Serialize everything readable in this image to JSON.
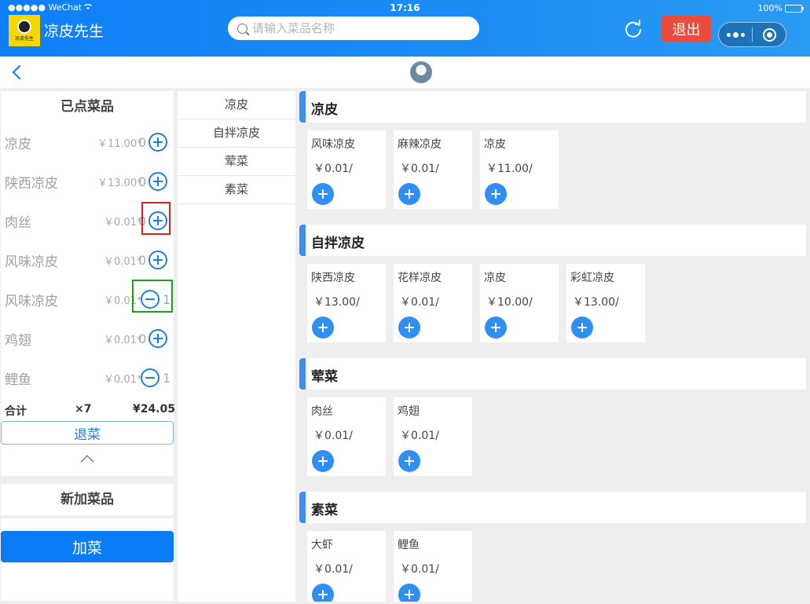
{
  "status": {
    "carrier": "●●●●● WeChat",
    "time": "17:16",
    "battery": "100%"
  },
  "header": {
    "app_name": "凉皮先生",
    "logo_text": "凉皮先生",
    "search_placeholder": "请输入菜品名称",
    "logout_label": "退出"
  },
  "ordered": {
    "title": "已点菜品",
    "items": [
      {
        "name": "凉皮",
        "price": "￥11.00*",
        "qty": "0",
        "action": "plus"
      },
      {
        "name": "陕西凉皮",
        "price": "￥13.00*",
        "qty": "0",
        "action": "plus"
      },
      {
        "name": "肉丝",
        "price": "￥0.01*",
        "qty": "0",
        "action": "plus"
      },
      {
        "name": "风味凉皮",
        "price": "￥0.01*",
        "qty": "0",
        "action": "plus"
      },
      {
        "name": "风味凉皮",
        "price": "￥0.01*",
        "qty": "1",
        "action": "minus"
      },
      {
        "name": "鸡翅",
        "price": "￥0.01*",
        "qty": "0",
        "action": "plus"
      },
      {
        "name": "鲤鱼",
        "price": "￥0.01*",
        "qty": "1",
        "action": "minus"
      }
    ],
    "total_label": "合计",
    "total_count": "×7",
    "total_amount": "¥24.05",
    "refund_label": "退菜"
  },
  "new_dishes": {
    "title": "新加菜品",
    "add_label": "加菜"
  },
  "categories": [
    "凉皮",
    "自拌凉皮",
    "荤菜",
    "素菜"
  ],
  "sections": [
    {
      "title": "凉皮",
      "dishes": [
        {
          "name": "风味凉皮",
          "price": "￥0.01/"
        },
        {
          "name": "麻辣凉皮",
          "price": "￥0.01/"
        },
        {
          "name": "凉皮",
          "price": "￥11.00/"
        }
      ]
    },
    {
      "title": "自拌凉皮",
      "dishes": [
        {
          "name": "陕西凉皮",
          "price": "￥13.00/"
        },
        {
          "name": "花样凉皮",
          "price": "￥0.01/"
        },
        {
          "name": "凉皮",
          "price": "￥10.00/"
        },
        {
          "name": "彩虹凉皮",
          "price": "￥13.00/"
        }
      ]
    },
    {
      "title": "荤菜",
      "dishes": [
        {
          "name": "肉丝",
          "price": "￥0.01/"
        },
        {
          "name": "鸡翅",
          "price": "￥0.01/"
        }
      ]
    },
    {
      "title": "素菜",
      "dishes": [
        {
          "name": "大虾",
          "price": "￥0.01/"
        },
        {
          "name": "鲤鱼",
          "price": "￥0.01/"
        }
      ]
    }
  ],
  "colors": {
    "primary": "#0a7cf7",
    "logout": "#e74c3c",
    "accent_bar": "#3b8ff0"
  }
}
